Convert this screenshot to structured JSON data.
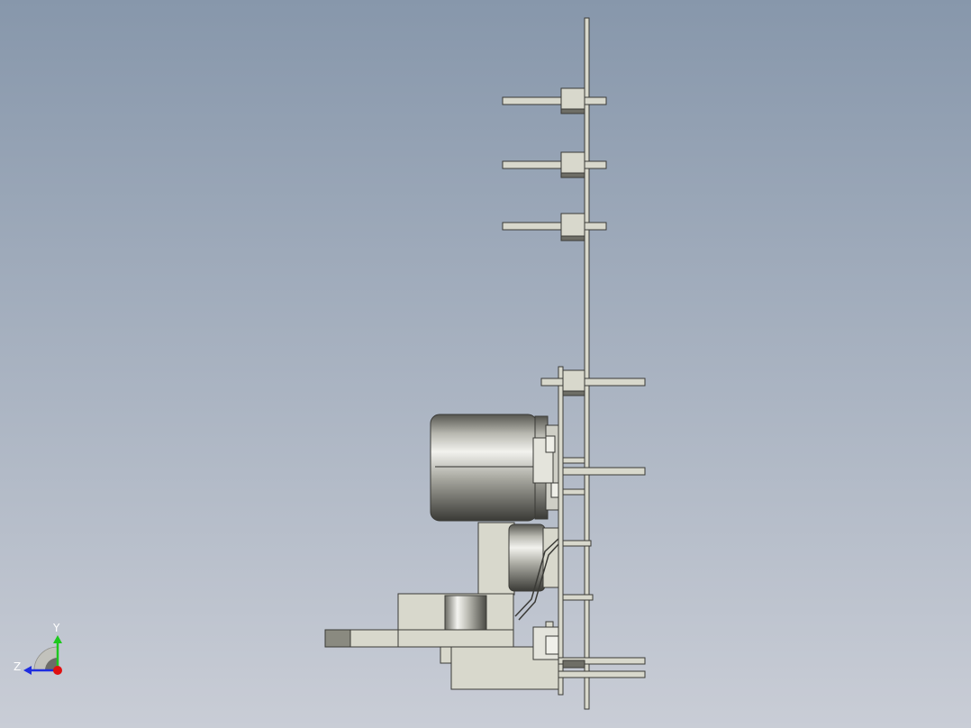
{
  "viewport": {
    "background_top": "#8797ab",
    "background_bottom": "#c9cdd6"
  },
  "triad": {
    "y_label": "Y",
    "z_label": "Z",
    "y_axis_color": "#1ec81e",
    "z_axis_color": "#1e2de0",
    "x_axis_color": "#e01010",
    "icon": "coordinate-triad-icon"
  },
  "colors": {
    "part_fill": "#d8d8cc",
    "part_fill_dark": "#6e6e66",
    "edge": "#3a3a36",
    "metal_light": "#eeeeea",
    "metal_dark": "#3c3c38"
  }
}
